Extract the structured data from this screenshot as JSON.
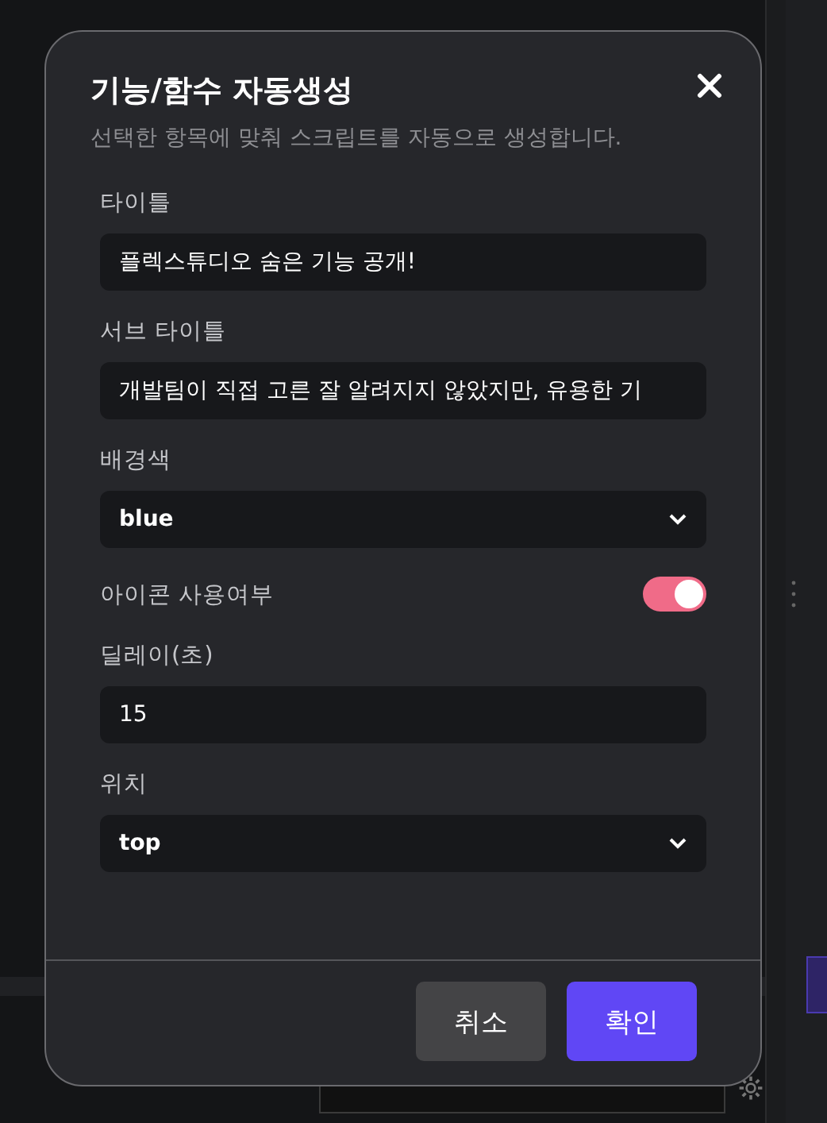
{
  "dialog": {
    "title": "기능/함수 자동생성",
    "subtitle": "선택한 항목에 맞춰 스크립트를 자동으로 생성합니다.",
    "fields": [
      {
        "kind": "text",
        "label": "타이틀",
        "value": "플렉스튜디오 숨은 기능 공개!"
      },
      {
        "kind": "text",
        "label": "서브 타이틀",
        "value": "개발팀이 직접 고른 잘 알려지지 않았지만, 유용한 기"
      },
      {
        "kind": "select",
        "label": "배경색",
        "value": "blue"
      },
      {
        "kind": "toggle",
        "label": "아이콘 사용여부",
        "on": true
      },
      {
        "kind": "text",
        "label": "딜레이(초)",
        "value": "15"
      },
      {
        "kind": "select",
        "label": "위치",
        "value": "top"
      }
    ],
    "buttons": [
      {
        "kind": "cancel",
        "label": "취소"
      },
      {
        "kind": "confirm",
        "label": "확인"
      }
    ]
  }
}
